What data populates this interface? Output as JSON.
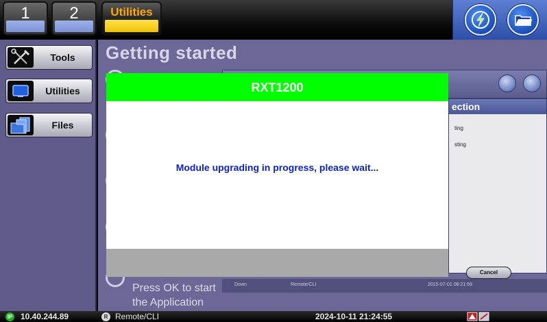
{
  "top_tabs": [
    {
      "label": "1"
    },
    {
      "label": "2"
    }
  ],
  "active_tab": {
    "label": "Utilities"
  },
  "sidebar": {
    "items": [
      {
        "label": "Tools",
        "icon": "tools-icon"
      },
      {
        "label": "Utilities",
        "icon": "monitor-icon"
      },
      {
        "label": "Files",
        "icon": "files-icon"
      }
    ]
  },
  "main": {
    "title": "Getting started",
    "press_ok": "Press OK to start",
    "the_application": "the Application"
  },
  "background_window": {
    "panel_title": "ection",
    "line1": "ting",
    "line2": "sting",
    "cancel_label": "Cancel",
    "status_down": "Down",
    "status_remote": "Remote/CLI",
    "status_time": "2015-07-01 08:21:59"
  },
  "dialog": {
    "title": "RXT1200",
    "message": "Module upgrading in progress, please wait..."
  },
  "statusbar": {
    "ip_icon": "IP",
    "ip": "10.40.244.89",
    "remote_icon": "R",
    "remote": "Remote/CLI",
    "datetime": "2024-10-11  21:24:55"
  },
  "colors": {
    "dialog_header": "#00ff00",
    "message_text": "#0a22c8",
    "utilities_label": "#ffa800",
    "sidebar_bg": "#5f5b8b"
  }
}
